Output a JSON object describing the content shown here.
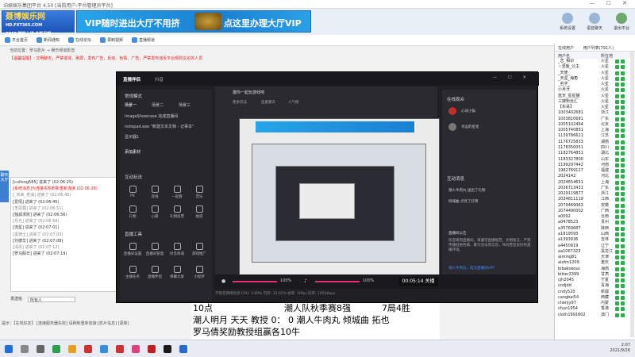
{
  "window": {
    "title": "泊娱娱乐集团平台 4.50 [当前用户:平台管理员平台]"
  },
  "header": {
    "logo_main": "聂博娱乐网",
    "logo_url": "HD.FXT365.COM",
    "logo_sub": "2015 精彩上线 全新呈现",
    "banner_left": "VIP随时进出大厅不用挤",
    "banner_right": "点这里办理大厅VIP",
    "banner_badge": "聂博娱乐",
    "buttons": [
      {
        "label": "系统设置"
      },
      {
        "label": "语音聊天"
      },
      {
        "label": "退出平台"
      }
    ]
  },
  "toolbar": {
    "items": [
      "平台首页",
      "新闻通知",
      "在线论坛",
      "录制视频",
      "直播频道"
    ]
  },
  "breadcrumb": "当前位置：罗马影片 → 娱乐频道影音",
  "notice": "【温馨提醒】: 文明聊天，严禁谩骂、刷屏，发布广告，反动、色情、广告，严禁发布违反平台规则言论的人员",
  "side_tab": "聊天大厅",
  "chat": {
    "lines": [
      {
        "t": "[cuilong585] 进来了 (02:06:25)",
        "c": "blk"
      },
      {
        "t": "[系统消息]为连接失败刷新重新连接 (02:06:26)",
        "c": "red"
      },
      {
        "t": "[_米来_老油] 进来了 (02:06:40)",
        "c": "grey"
      },
      {
        "t": "[爱情] 进来了 (02:06:45)",
        "c": "blk"
      },
      {
        "t": "[李思露] 进来了 (02:06:51)",
        "c": "grey"
      },
      {
        "t": "[独孤求败] 进来了 (02:06:56)",
        "c": "blk"
      },
      {
        "t": "[月光] 进来了 (02:06:58)",
        "c": "grey"
      },
      {
        "t": "[流星] 进来了 (02:07:01)",
        "c": "blk"
      },
      {
        "t": "[黑骑士] 进来了 (02:07:03)",
        "c": "grey"
      },
      {
        "t": "[刘德华] 进来了 (02:07:08)",
        "c": "blk"
      },
      {
        "t": "[清风] 进来了 (02:07:12)",
        "c": "grey"
      },
      {
        "t": "[罗马假日] 进来了 (02:07:19)",
        "c": "blk"
      }
    ],
    "say_label": "发送给",
    "say_target": "所有人"
  },
  "tips": "提示：【在线好友】 [连接服务器失败] 请刷新重新连接 [影片信息] [更新]",
  "right": {
    "tabs": [
      "在线用户",
      "用户列表(791人)"
    ],
    "header_name": "用户名",
    "header_loc": "所在地",
    "users": [
      {
        "n": "_恋_相识",
        "loc": "火星"
      },
      {
        "n": "☆涅槃_公主",
        "loc": "火星"
      },
      {
        "n": "_天使_",
        "loc": "火星"
      },
      {
        "n": "_天涯_海角",
        "loc": "火星"
      },
      {
        "n": "_名字_",
        "loc": "火星"
      },
      {
        "n": "小月牙",
        "loc": "火星"
      },
      {
        "n": "蓝天_星星猫",
        "loc": "火星"
      },
      {
        "n": "三嫂粉丝汇",
        "loc": "火星"
      },
      {
        "n": "【东哥】",
        "loc": "火星"
      },
      {
        "n": "1003402681",
        "loc": "浙江"
      },
      {
        "n": "1003810681",
        "loc": "广东"
      },
      {
        "n": "1005102464",
        "loc": "北京"
      },
      {
        "n": "1005740851",
        "loc": "上海"
      },
      {
        "n": "1139786621",
        "loc": "江苏"
      },
      {
        "n": "1176725833",
        "loc": "湖南"
      },
      {
        "n": "1178350051",
        "loc": "四川"
      },
      {
        "n": "1182764851",
        "loc": "湖北"
      },
      {
        "n": "1183327800",
        "loc": "山东"
      },
      {
        "n": "1199297442",
        "loc": "河南"
      },
      {
        "n": "1982769127",
        "loc": "福建"
      },
      {
        "n": "2024142",
        "loc": "河北"
      },
      {
        "n": "2024654651",
        "loc": "上海"
      },
      {
        "n": "2026713431",
        "loc": "广东"
      },
      {
        "n": "2029119877",
        "loc": "浙江"
      },
      {
        "n": "2034811119",
        "loc": "江西"
      },
      {
        "n": "2079469063",
        "loc": "安徽"
      },
      {
        "n": "2074490002",
        "loc": "广西"
      },
      {
        "n": "a0092",
        "loc": "云南"
      },
      {
        "n": "a0478523",
        "loc": "贵州"
      },
      {
        "n": "a35769687",
        "loc": "陕西"
      },
      {
        "n": "a1819593",
        "loc": "山西"
      },
      {
        "n": "a1393936",
        "loc": "吉林"
      },
      {
        "n": "a4450919",
        "loc": "辽宁"
      },
      {
        "n": "aa1067323",
        "loc": "黑龙江"
      },
      {
        "n": "aiming81",
        "loc": "天津"
      },
      {
        "n": "alxfm1209",
        "loc": "重庆"
      },
      {
        "n": "bibakokoss",
        "loc": "海南"
      },
      {
        "n": "bitter3399",
        "loc": "甘肃"
      },
      {
        "n": "cjh2045",
        "loc": "宁夏"
      },
      {
        "n": "cndjdd",
        "loc": "青海"
      },
      {
        "n": "cndy520",
        "loc": "新疆"
      },
      {
        "n": "cangbai54",
        "loc": "西藏"
      },
      {
        "n": "chenjy97",
        "loc": "内蒙"
      },
      {
        "n": "chun1954",
        "loc": "香港"
      },
      {
        "n": "cloth1991802",
        "loc": "澳门"
      }
    ]
  },
  "obs": {
    "title": "直播伴侣",
    "title_sub": "抖音",
    "scene_header": "常规模式",
    "scene_tabs": [
      "场景一",
      "场景二",
      "场景三"
    ],
    "sources": [
      "ImageShowcase 完成直播间",
      "notepad.exe \"新建文本文档 - 记事本\"",
      "显示器1"
    ],
    "add_source": "添加素材",
    "interact_label": "互动玩法",
    "tools_row1": [
      "PK",
      "连线",
      "一起看",
      "音乐"
    ],
    "tools_row2": [
      "礼物",
      "心愿",
      "礼物投票",
      "福袋"
    ],
    "tools_header": "直播工具",
    "tools_row3": [
      "直播间设置",
      "直播间管理",
      "抖音商城",
      "游戏推广"
    ],
    "tools_row4": [
      "主播任务",
      "直播伴侣",
      "弹幕大屏",
      "小程序"
    ],
    "room_title": "邀你一起玩游戏吧",
    "room_tag1": "更多玩法",
    "room_tag2": "连麦聊天",
    "room_tag3": "人气榜",
    "rank_title": "在线观众",
    "rank": [
      {
        "name": "心动小猫"
      },
      {
        "name": "幸运的星星"
      }
    ],
    "interact_title": "互动消息",
    "msgs": [
      "潮人牛肉丸 送出了礼物",
      "倾城曲 点亮了灯牌"
    ],
    "chat_title": "直播间公告",
    "chat_text": "欢迎来到直播间，请遵守直播规范，文明发言，严禁传播低俗色情、暴力违法等信息，共同营造良好的直播环境。",
    "chat_reply": "潮人牛肉丸：成为直播间VIP!",
    "vol1": "100%",
    "vol2": "100%",
    "live_time": "00:05:14",
    "live_btn": "关播",
    "status": "不稳定网络检测  CPU: 3.69%  内存: 33.02%  帧率: 30fps  码率: 1859kbps",
    "vol1_pct": 100,
    "vol2_pct": 100
  },
  "overlay": {
    "line1a": "10点",
    "line1b": "潮人队秋季赛8强",
    "line1c": "7局4胜",
    "line2": "潮人明月  天天  教授 0： 0  潮人牛肉丸  倾城曲  拓也",
    "line3": "罗马倩奖励教授组赢各10牛"
  },
  "taskbar": {
    "time": "2:07",
    "date": "2021/9/26"
  }
}
